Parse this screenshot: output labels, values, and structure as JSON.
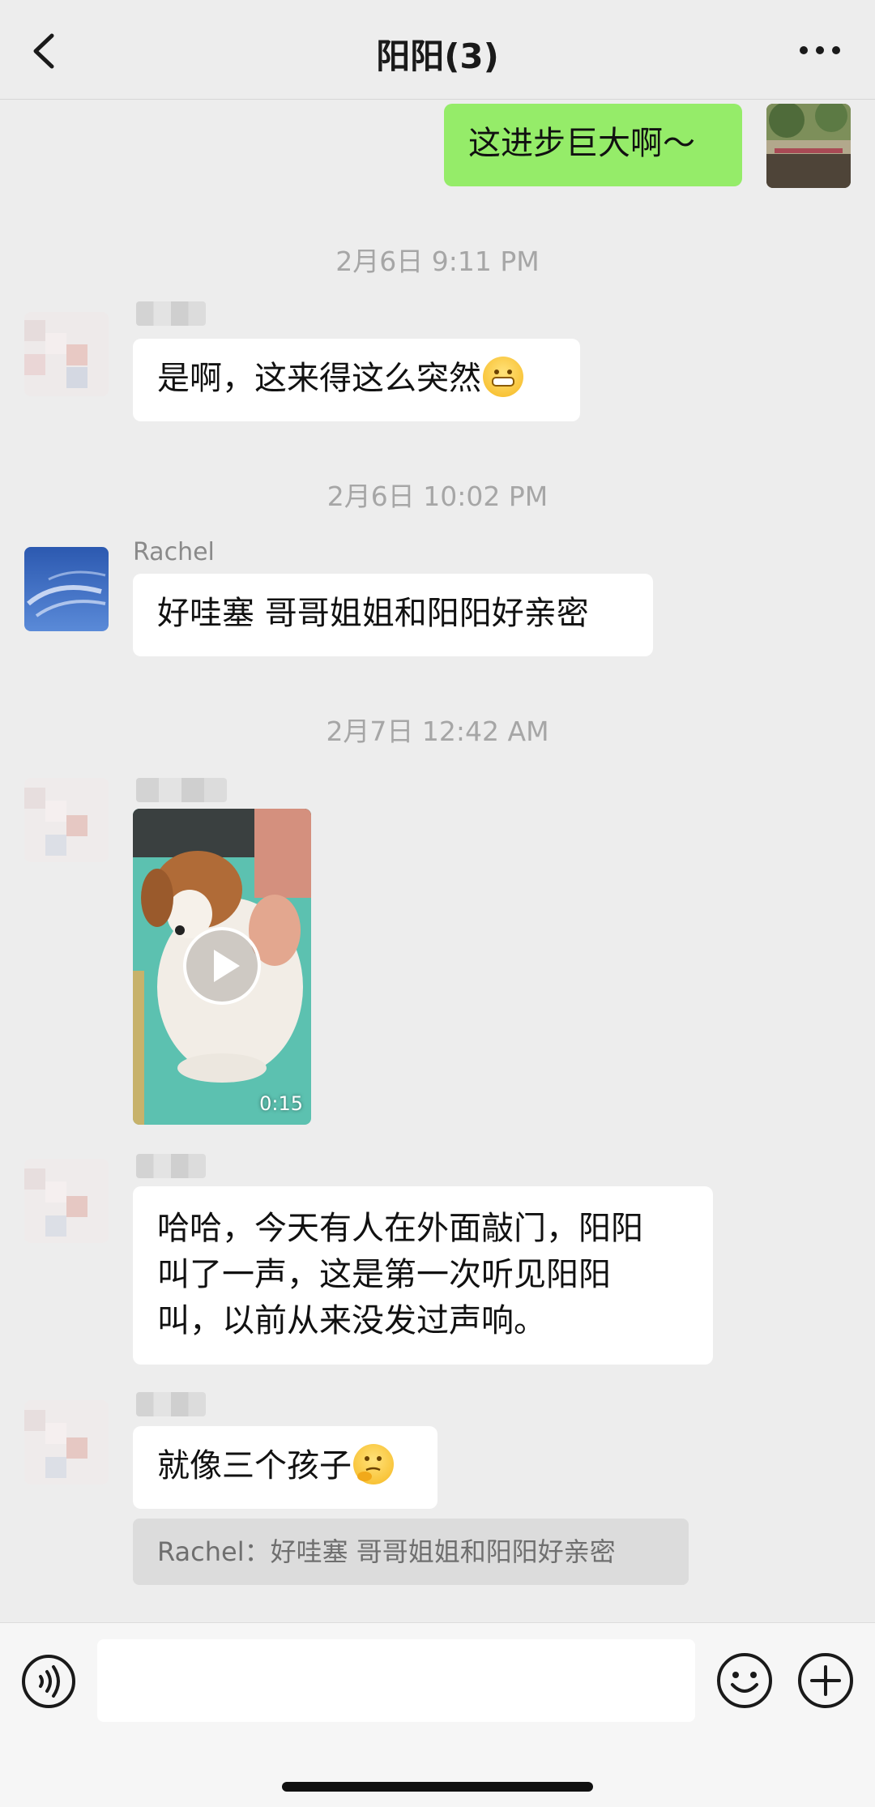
{
  "header": {
    "title": "阳阳(3)",
    "back_icon": "chevron-left-icon",
    "more_icon": "more-dots-icon"
  },
  "messages": {
    "m1": {
      "text": "这进步巨大啊～"
    },
    "ts1": "2月6日 9:11 PM",
    "m2": {
      "text": "是啊，这来得这么突然"
    },
    "ts2": "2月6日 10:02 PM",
    "m3": {
      "sender": "Rachel",
      "text": "好哇塞 哥哥姐姐和阳阳好亲密"
    },
    "ts3": "2月7日 12:42 AM",
    "m4": {
      "video_duration": "0:15"
    },
    "m5": {
      "lines": [
        "哈哈，今天有人在外面敲门，阳阳",
        "叫了一声，这是第一次听见阳阳",
        "叫，以前从来没发过声响。"
      ]
    },
    "m6": {
      "text": "就像三个孩子",
      "quote": "Rachel：好哇塞 哥哥姐姐和阳阳好亲密"
    }
  },
  "input": {
    "value": "",
    "placeholder": ""
  },
  "colors": {
    "background": "#ededed",
    "sent_bubble": "#95ec69",
    "received_bubble": "#ffffff"
  }
}
